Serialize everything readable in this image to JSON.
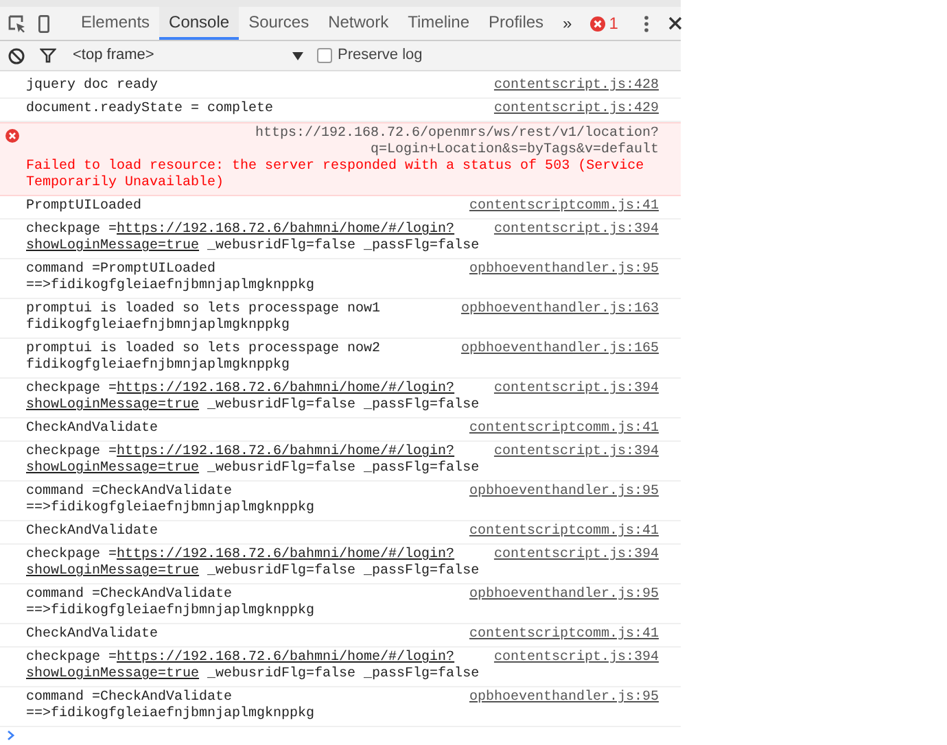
{
  "tabs": [
    {
      "label": "Elements",
      "selected": false
    },
    {
      "label": "Console",
      "selected": true
    },
    {
      "label": "Sources",
      "selected": false
    },
    {
      "label": "Network",
      "selected": false
    },
    {
      "label": "Timeline",
      "selected": false
    },
    {
      "label": "Profiles",
      "selected": false
    }
  ],
  "more_tabs": "»",
  "error_count": "1",
  "context_select": {
    "value": "<top frame>"
  },
  "preserve_log": {
    "label": "Preserve log",
    "checked": false
  },
  "messages": [
    {
      "kind": "log",
      "lines": [
        "jquery doc ready"
      ],
      "source": "contentscript.js:428"
    },
    {
      "kind": "log",
      "lines": [
        "document.readyState = complete"
      ],
      "source": "contentscript.js:429"
    },
    {
      "kind": "error",
      "source_lines": [
        "https://192.168.72.6/openmrs/ws/rest/v1/location?",
        "q=Login+Location&s=byTags&v=default"
      ],
      "text": "Failed to load resource: the server responded with a status of 503 (Service Temporarily Unavailable)"
    },
    {
      "kind": "log",
      "lines": [
        "PromptUILoaded"
      ],
      "source": "contentscriptcomm.js:41"
    },
    {
      "kind": "checkpage",
      "prefix": "checkpage =",
      "url_start": "https://192.168.72.6/bahmni/home/#/login?",
      "url_end": "showLoginMessage=true",
      "suffix": " _webusridFlg=false _passFlg=false",
      "source": "contentscript.js:394"
    },
    {
      "kind": "log",
      "lines": [
        "command =PromptUILoaded",
        "==>fidikogfgleiaefnjbmnjaplmgknppkg"
      ],
      "source": "opbhoeventhandler.js:95"
    },
    {
      "kind": "log",
      "lines": [
        "promptui is loaded so lets processpage now1",
        "fidikogfgleiaefnjbmnjaplmgknppkg"
      ],
      "source": "opbhoeventhandler.js:163"
    },
    {
      "kind": "log",
      "lines": [
        "promptui is loaded so lets processpage now2",
        "fidikogfgleiaefnjbmnjaplmgknppkg"
      ],
      "source": "opbhoeventhandler.js:165"
    },
    {
      "kind": "checkpage",
      "prefix": "checkpage =",
      "url_start": "https://192.168.72.6/bahmni/home/#/login?",
      "url_end": "showLoginMessage=true",
      "suffix": " _webusridFlg=false _passFlg=false",
      "source": "contentscript.js:394"
    },
    {
      "kind": "log",
      "lines": [
        "CheckAndValidate"
      ],
      "source": "contentscriptcomm.js:41"
    },
    {
      "kind": "checkpage",
      "prefix": "checkpage =",
      "url_start": "https://192.168.72.6/bahmni/home/#/login?",
      "url_end": "showLoginMessage=true",
      "suffix": " _webusridFlg=false _passFlg=false",
      "source": "contentscript.js:394"
    },
    {
      "kind": "log",
      "lines": [
        "command =CheckAndValidate",
        "==>fidikogfgleiaefnjbmnjaplmgknppkg"
      ],
      "source": "opbhoeventhandler.js:95"
    },
    {
      "kind": "log",
      "lines": [
        "CheckAndValidate"
      ],
      "source": "contentscriptcomm.js:41"
    },
    {
      "kind": "checkpage",
      "prefix": "checkpage =",
      "url_start": "https://192.168.72.6/bahmni/home/#/login?",
      "url_end": "showLoginMessage=true",
      "suffix": " _webusridFlg=false _passFlg=false",
      "source": "contentscript.js:394"
    },
    {
      "kind": "log",
      "lines": [
        "command =CheckAndValidate",
        "==>fidikogfgleiaefnjbmnjaplmgknppkg"
      ],
      "source": "opbhoeventhandler.js:95"
    },
    {
      "kind": "log",
      "lines": [
        "CheckAndValidate"
      ],
      "source": "contentscriptcomm.js:41"
    },
    {
      "kind": "checkpage",
      "prefix": "checkpage =",
      "url_start": "https://192.168.72.6/bahmni/home/#/login?",
      "url_end": "showLoginMessage=true",
      "suffix": " _webusridFlg=false _passFlg=false",
      "source": "contentscript.js:394"
    },
    {
      "kind": "log",
      "lines": [
        "command =CheckAndValidate",
        "==>fidikogfgleiaefnjbmnjaplmgknppkg"
      ],
      "source": "opbhoeventhandler.js:95"
    }
  ]
}
